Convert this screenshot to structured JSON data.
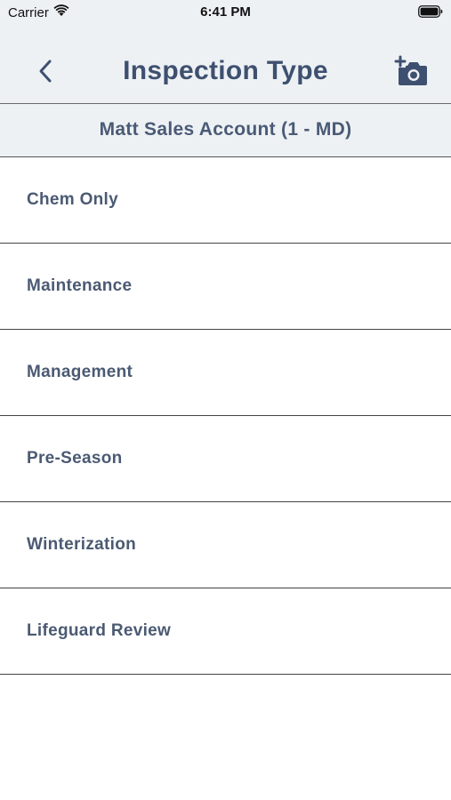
{
  "status_bar": {
    "carrier": "Carrier",
    "time": "6:41 PM",
    "wifi_icon": "wifi-icon",
    "battery_icon": "battery-icon"
  },
  "nav": {
    "title": "Inspection Type",
    "back_icon": "chevron-left-icon",
    "camera_icon": "add-photo-camera-icon",
    "accent_color": "#3e5070"
  },
  "account": {
    "name": "Matt Sales Account (1 - MD)"
  },
  "inspection_types": [
    {
      "label": "Chem Only"
    },
    {
      "label": "Maintenance"
    },
    {
      "label": "Management"
    },
    {
      "label": "Pre-Season"
    },
    {
      "label": "Winterization"
    },
    {
      "label": "Lifeguard Review"
    }
  ]
}
